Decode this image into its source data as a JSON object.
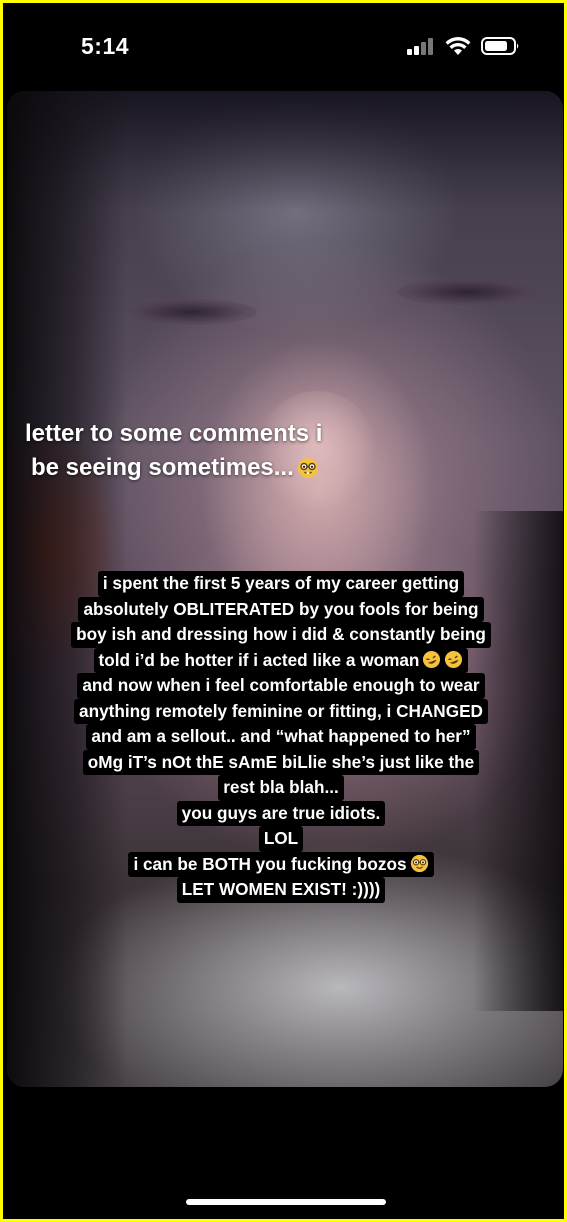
{
  "status_bar": {
    "time": "5:14",
    "signal_icon": "cellular-signal-icon",
    "wifi_icon": "wifi-icon",
    "battery_icon": "battery-icon"
  },
  "story": {
    "headline_line1": "letter to some comments i",
    "headline_line2": "be seeing sometimes...",
    "headline_emoji": "nerd-face-emoji",
    "caption_lines": [
      {
        "text": "i spent the first 5 years of my career getting"
      },
      {
        "text": "absolutely OBLITERATED by you fools for being"
      },
      {
        "text": "boy ish and dressing how i did & constantly being"
      },
      {
        "text": "told i’d be hotter if i acted like a woman",
        "emoji": "rofl-emoji-x2"
      },
      {
        "text": "and now when i feel comfortable enough to wear"
      },
      {
        "text": "anything remotely feminine or fitting, i CHANGED"
      },
      {
        "text": "and am a sellout.. and “what happened to her”"
      },
      {
        "text": "oMg iT’s nOt thE sAmE biLlie she’s just like the"
      },
      {
        "text": "rest bla blah..."
      },
      {
        "text": "you guys are true idiots."
      },
      {
        "text": "LOL"
      },
      {
        "text": "i can be BOTH you fucking bozos",
        "emoji": "nerd-face-emoji"
      },
      {
        "text": "LET WOMEN EXIST! :))))"
      }
    ]
  },
  "colors": {
    "frame_border": "#ffff00",
    "caption_background": "#000000",
    "caption_text": "#ffffff"
  }
}
